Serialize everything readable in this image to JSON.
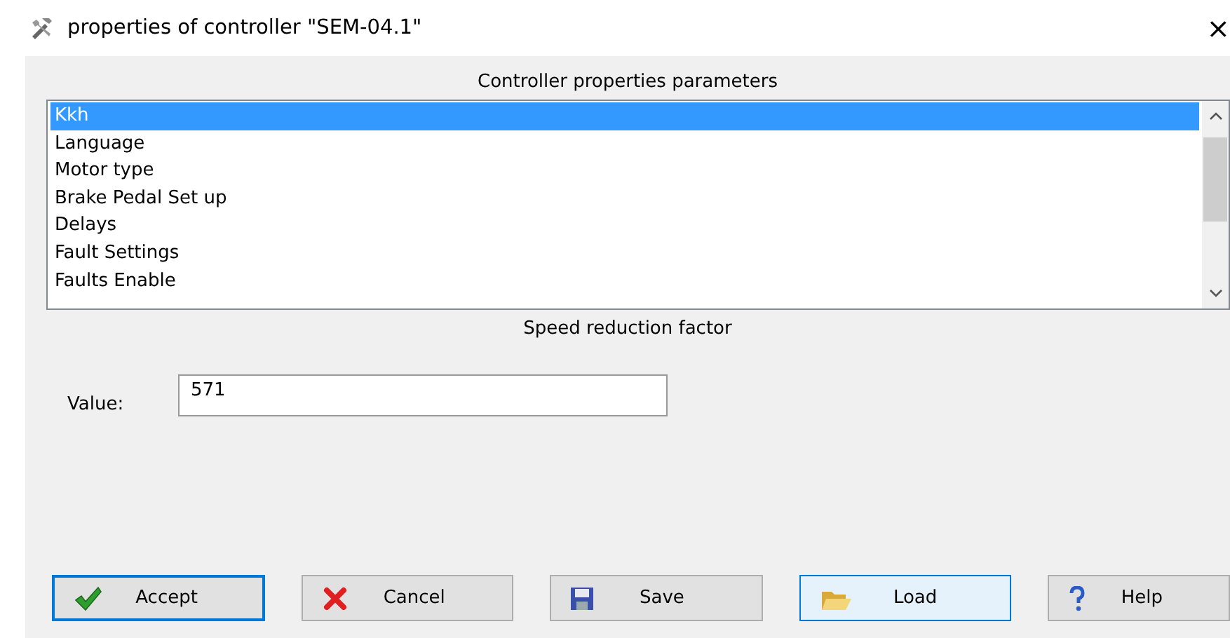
{
  "window": {
    "title": "properties of controller \"SEM-04.1\"",
    "close": "×"
  },
  "list": {
    "heading": "Controller properties parameters",
    "items": [
      {
        "label": "Kkh",
        "selected": true
      },
      {
        "label": "Language",
        "selected": false
      },
      {
        "label": "Motor type",
        "selected": false
      },
      {
        "label": "Brake Pedal Set up",
        "selected": false
      },
      {
        "label": "Delays",
        "selected": false
      },
      {
        "label": "Fault Settings",
        "selected": false
      },
      {
        "label": "Faults Enable",
        "selected": false
      }
    ]
  },
  "parameter": {
    "heading": "Speed reduction factor",
    "label": "Value:",
    "value": "571"
  },
  "buttons": [
    {
      "label": "Accept",
      "kind": "accept",
      "focused": true,
      "hovered": false
    },
    {
      "label": "Cancel",
      "kind": "cancel",
      "focused": false,
      "hovered": false
    },
    {
      "label": "Save",
      "kind": "save",
      "focused": false,
      "hovered": false
    },
    {
      "label": "Load",
      "kind": "load",
      "focused": false,
      "hovered": true
    },
    {
      "label": "Help",
      "kind": "help",
      "focused": false,
      "hovered": false
    }
  ]
}
